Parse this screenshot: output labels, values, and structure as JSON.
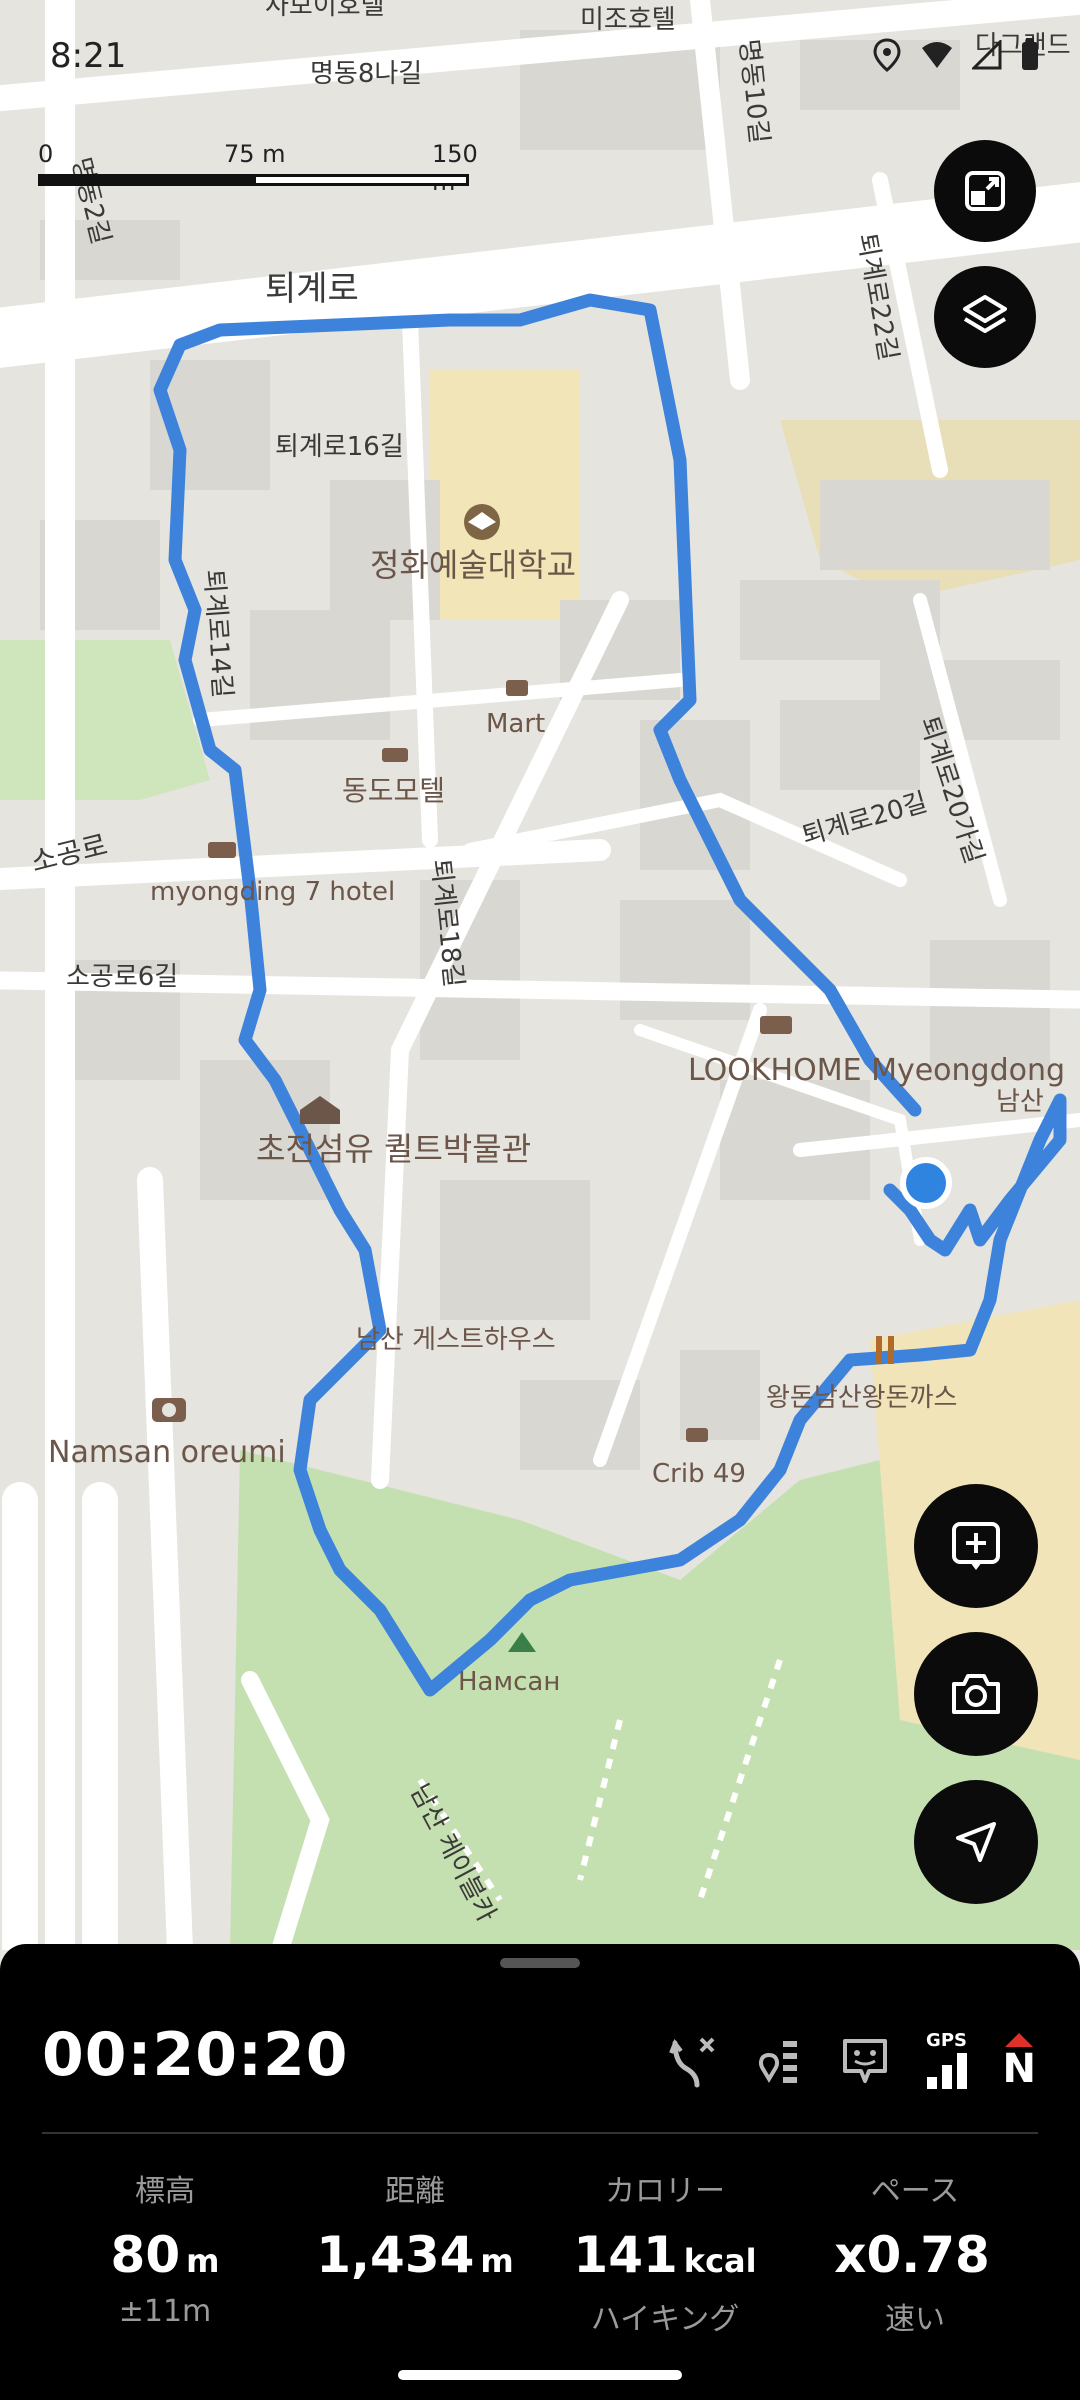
{
  "status_bar": {
    "time": "8:21"
  },
  "scale_bar": {
    "labels": [
      "0",
      "75 m",
      "150 m"
    ]
  },
  "map": {
    "street_labels": [
      "퇴계로",
      "명동8나길",
      "명동10길",
      "퇴계로16길",
      "퇴계로14길",
      "퇴계로18길",
      "퇴계로20길",
      "퇴계로20가길",
      "퇴계로22길",
      "소공로",
      "소공로6길",
      "남산 케이블카",
      "미조호텔",
      "사보이호텔",
      "다그랜드",
      "명동2길"
    ],
    "poi_labels": [
      "정화예술대학교",
      "Mart",
      "동도모텔",
      "myongding 7 hotel",
      "LOOKHOME Myeongdong",
      "초전섬유 퀼트박물관",
      "남산 게스트하우스",
      "Namsan oreumi",
      "Crib 49",
      "왕돈남산왕돈까스",
      "Намсан",
      "남산"
    ]
  },
  "map_buttons": [
    "layout-toggle",
    "layers",
    "add-waypoint",
    "camera",
    "my-location"
  ],
  "tracking": {
    "timer": "00:20:20",
    "stats": [
      {
        "title": "標高",
        "value": "80",
        "unit": "m",
        "sub": "±11m"
      },
      {
        "title": "距離",
        "value": "1,434",
        "unit": "m",
        "sub": ""
      },
      {
        "title": "カロリー",
        "value": "141",
        "unit": "kcal",
        "sub": "ハイキング"
      },
      {
        "title": "ペース",
        "value": "x0.78",
        "unit": "",
        "sub": "速い"
      }
    ],
    "gps_label": "GPS",
    "compass_label": "N"
  },
  "colors": {
    "route": "#3d83dc",
    "location_dot": "#2f84e0",
    "sheet_bg": "#000000",
    "fab_bg": "#0b0b0b"
  }
}
